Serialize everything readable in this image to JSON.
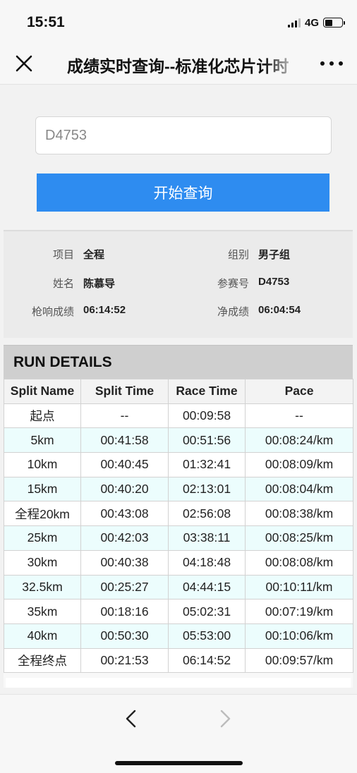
{
  "status_bar": {
    "time": "15:51",
    "network": "4G"
  },
  "nav": {
    "title": "成绩实时查询--标准化芯片计时"
  },
  "search": {
    "value": "D4753",
    "button_label": "开始查询"
  },
  "info": {
    "project_label": "项目",
    "project_value": "全程",
    "group_label": "组别",
    "group_value": "男子组",
    "name_label": "姓名",
    "name_value": "陈慕导",
    "bib_label": "参赛号",
    "bib_value": "D4753",
    "gun_time_label": "枪响成绩",
    "gun_time_value": "06:14:52",
    "net_time_label": "净成绩",
    "net_time_value": "06:04:54"
  },
  "run_details": {
    "title": "RUN DETAILS",
    "columns": [
      "Split Name",
      "Split Time",
      "Race Time",
      "Pace"
    ],
    "rows": [
      [
        "起点",
        "--",
        "00:09:58",
        "--"
      ],
      [
        "5km",
        "00:41:58",
        "00:51:56",
        "00:08:24/km"
      ],
      [
        "10km",
        "00:40:45",
        "01:32:41",
        "00:08:09/km"
      ],
      [
        "15km",
        "00:40:20",
        "02:13:01",
        "00:08:04/km"
      ],
      [
        "全程20km",
        "00:43:08",
        "02:56:08",
        "00:08:38/km"
      ],
      [
        "25km",
        "00:42:03",
        "03:38:11",
        "00:08:25/km"
      ],
      [
        "30km",
        "00:40:38",
        "04:18:48",
        "00:08:08/km"
      ],
      [
        "32.5km",
        "00:25:27",
        "04:44:15",
        "00:10:11/km"
      ],
      [
        "35km",
        "00:18:16",
        "05:02:31",
        "00:07:19/km"
      ],
      [
        "40km",
        "00:50:30",
        "05:53:00",
        "00:10:06/km"
      ],
      [
        "全程终点",
        "00:21:53",
        "06:14:52",
        "00:09:57/km"
      ]
    ]
  },
  "colors": {
    "accent": "#2e8cf0",
    "row_alt": "#ecfdfd"
  }
}
